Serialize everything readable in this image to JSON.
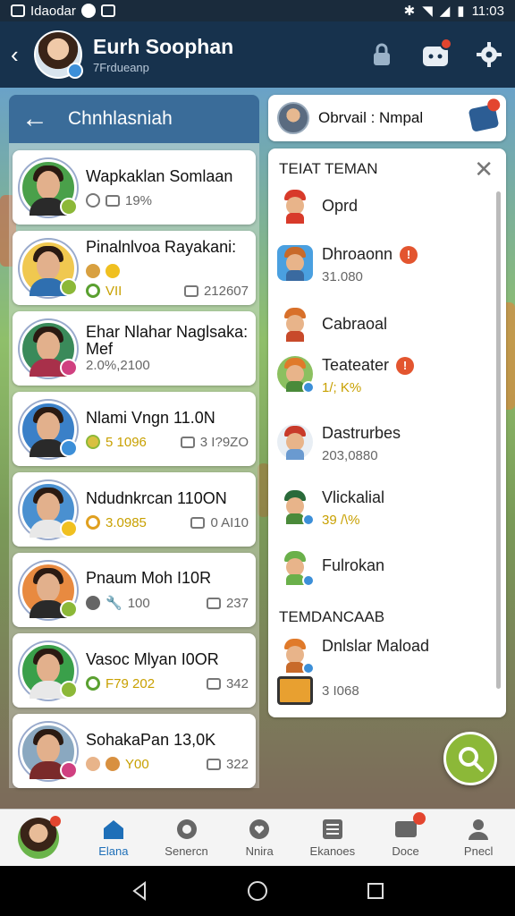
{
  "status_bar": {
    "carrier": "Idaodar",
    "time": "11:03"
  },
  "header": {
    "title": "Eurh Soophan",
    "subtitle": "7Frdueanp"
  },
  "left_panel": {
    "title": "Chnhlasniah",
    "friends": [
      {
        "name": "Wapkaklan Somlaan",
        "stat1": "19%",
        "stat2": ""
      },
      {
        "name": "Pinalnlvoa Rayakani:",
        "stat1": "VII",
        "stat2": "212607"
      },
      {
        "name": "Ehar Nlahar Naglsaka: Mef",
        "stat1": "2.0%,2100",
        "stat2": ""
      },
      {
        "name": "Nlami Vngn 11.0N",
        "stat1": "5 1096",
        "stat2": "3 I?9ZO"
      },
      {
        "name": "Ndudnkrcan 110ON",
        "stat1": "3.0985",
        "stat2": "0 AI10"
      },
      {
        "name": "Pnaum Moh I10R",
        "stat1": "100",
        "stat2": "237"
      },
      {
        "name": "Vasoc Mlyan I0OR",
        "stat1": "F79 202",
        "stat2": "342"
      },
      {
        "name": "SohakaPan 13,0K",
        "stat1": "Y00",
        "stat2": "322"
      }
    ]
  },
  "right_top": {
    "label": "Obrvail : Nmpal"
  },
  "right_panel": {
    "section1": "TEIAT TEMAN",
    "items": [
      {
        "name": "Oprd",
        "value": ""
      },
      {
        "name": "Dhroaonn",
        "value": "31.080"
      },
      {
        "name": "Cabraoal",
        "value": ""
      },
      {
        "name": "Teateater",
        "value": "1/; K%"
      },
      {
        "name": "Dastrurbes",
        "value": "203,0880"
      },
      {
        "name": "Vlickalial",
        "value": "39 /\\%"
      },
      {
        "name": "Fulrokan",
        "value": ""
      }
    ],
    "section2": "TEMDANCAAB",
    "items2": [
      {
        "name": "Dnlslar Maload",
        "value": "3 I068"
      }
    ]
  },
  "bottom_nav": {
    "items": [
      {
        "label": "Elana"
      },
      {
        "label": "Senercn"
      },
      {
        "label": "Nnira"
      },
      {
        "label": "Ekanoes"
      },
      {
        "label": "Doce"
      },
      {
        "label": "Pnecl"
      }
    ]
  },
  "colors": {
    "header_bg": "#17324d",
    "accent_blue": "#1e6fb8",
    "fab_green": "#8cb838",
    "badge_red": "#e3452f"
  }
}
